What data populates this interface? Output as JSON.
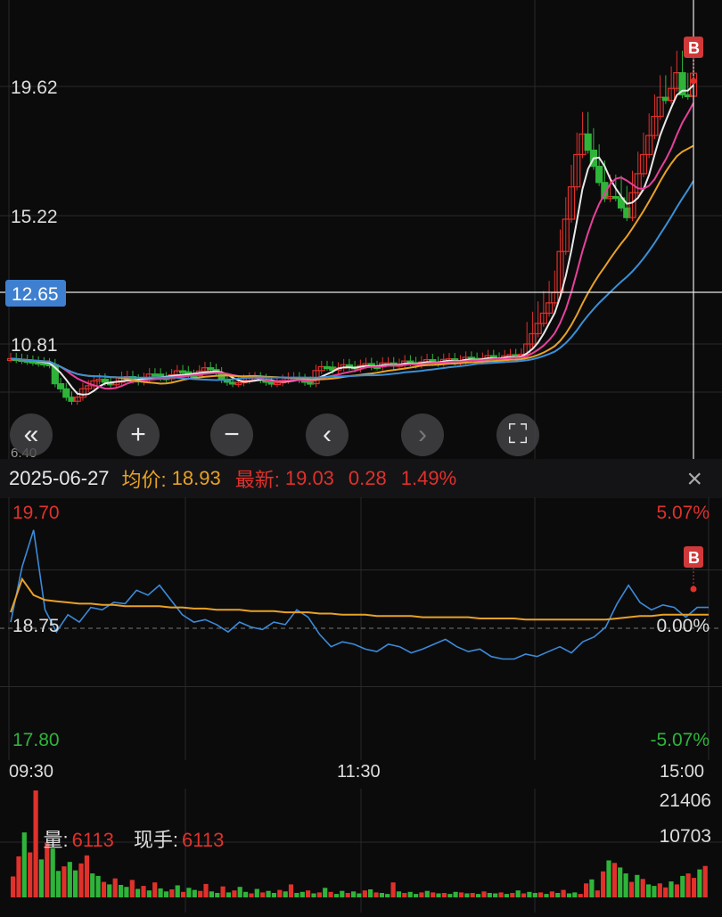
{
  "kline": {
    "price_levels": [
      "19.62",
      "15.22",
      "10.81"
    ],
    "current_price_label": "12.65",
    "bottom_label": "6.40",
    "buy_marker": "B",
    "colors": {
      "up": "#e0312b",
      "down": "#2fb43a",
      "ma5": "#e8e8e8",
      "ma10": "#e8409a",
      "ma20": "#e8a126",
      "ma30": "#3a8fd6",
      "price_tag": "#3f7fd0"
    }
  },
  "controls": [
    {
      "name": "rewind-button",
      "icon": "double-chevron-left-icon",
      "glyph": "«",
      "enabled": true
    },
    {
      "name": "zoom-in-button",
      "icon": "plus-icon",
      "glyph": "+",
      "enabled": true
    },
    {
      "name": "zoom-out-button",
      "icon": "minus-icon",
      "glyph": "−",
      "enabled": true
    },
    {
      "name": "prev-button",
      "icon": "chevron-left-icon",
      "glyph": "‹",
      "enabled": true
    },
    {
      "name": "next-button",
      "icon": "chevron-right-icon",
      "glyph": "›",
      "enabled": false
    },
    {
      "name": "fullscreen-button",
      "icon": "expand-icon",
      "glyph": "⛶",
      "enabled": true
    }
  ],
  "info": {
    "date": "2025-06-27",
    "avg_label": "均价:",
    "avg_value": "18.93",
    "latest_label": "最新:",
    "latest_value": "19.03",
    "change": "0.28",
    "change_pct": "1.49%",
    "close_glyph": "×"
  },
  "chart_data": {
    "type": "line",
    "title": "",
    "y_labels": {
      "top_left": "19.70",
      "mid_left": "18.75",
      "bottom_left": "17.80",
      "top_right": "5.07%",
      "mid_right": "0.00%",
      "bottom_right": "-5.07%"
    },
    "ylim": [
      17.8,
      19.7
    ],
    "reference": 18.75,
    "x_ticks": [
      "09:30",
      "11:30",
      "15:00"
    ],
    "series": [
      {
        "values": [
          18.8,
          19.25,
          19.55,
          18.9,
          18.72,
          18.86,
          18.8,
          18.92,
          18.9,
          18.96,
          18.95,
          19.06,
          19.02,
          19.1,
          18.98,
          18.86,
          18.8,
          18.82,
          18.78,
          18.72,
          18.8,
          18.76,
          18.74,
          18.8,
          18.78,
          18.9,
          18.84,
          18.7,
          18.6,
          18.64,
          18.62,
          18.58,
          18.56,
          18.62,
          18.6,
          18.55,
          18.58,
          18.62,
          18.66,
          18.6,
          18.56,
          18.58,
          18.52,
          18.5,
          18.5,
          18.54,
          18.52,
          18.56,
          18.6,
          18.55,
          18.64,
          18.68,
          18.76,
          18.95,
          19.1,
          18.96,
          18.9,
          18.94,
          18.92,
          18.84,
          18.92,
          18.92
        ]
      },
      {
        "values": [
          18.88,
          19.15,
          19.02,
          18.98,
          18.97,
          18.96,
          18.95,
          18.95,
          18.94,
          18.94,
          18.93,
          18.93,
          18.93,
          18.93,
          18.92,
          18.92,
          18.91,
          18.91,
          18.9,
          18.9,
          18.9,
          18.89,
          18.89,
          18.89,
          18.88,
          18.88,
          18.88,
          18.87,
          18.87,
          18.86,
          18.86,
          18.86,
          18.85,
          18.85,
          18.85,
          18.85,
          18.84,
          18.84,
          18.84,
          18.84,
          18.84,
          18.83,
          18.83,
          18.83,
          18.83,
          18.82,
          18.82,
          18.82,
          18.82,
          18.82,
          18.82,
          18.82,
          18.82,
          18.83,
          18.84,
          18.85,
          18.85,
          18.86,
          18.86,
          18.86,
          18.86,
          18.86
        ]
      }
    ],
    "volume": {
      "labels": {
        "vol_label": "量:",
        "vol_value": "6113",
        "hand_label": "现手:",
        "hand_value": "6113",
        "ymax": "21406",
        "ymid": "10703"
      },
      "ylim": [
        0,
        21406
      ],
      "values": [
        4200,
        8200,
        13000,
        9000,
        21406,
        7600,
        11000,
        9800,
        5300,
        6200,
        7100,
        5400,
        6800,
        8400,
        4800,
        4300,
        3100,
        2600,
        3800,
        2500,
        2100,
        3500,
        1700,
        2300,
        1400,
        3000,
        1800,
        1200,
        1600,
        2400,
        1100,
        1900,
        1500,
        1300,
        2700,
        1200,
        900,
        2200,
        1000,
        1400,
        2100,
        1100,
        800,
        1700,
        1000,
        1300,
        900,
        1500,
        1200,
        2600,
        900,
        1100,
        1400,
        800,
        1000,
        1900,
        1100,
        700,
        1300,
        900,
        1200,
        800,
        1400,
        1600,
        1000,
        900,
        700,
        3000,
        1200,
        900,
        1100,
        700,
        1000,
        1300,
        1000,
        800,
        900,
        700,
        1100,
        1000,
        800,
        900,
        700,
        1200,
        900,
        800,
        1000,
        700,
        900,
        1400,
        800,
        1100,
        900,
        1000,
        700,
        1200,
        900,
        1500,
        800,
        1000,
        700,
        2800,
        3600,
        1400,
        5200,
        7400,
        6900,
        6000,
        4800,
        3100,
        4500,
        3700,
        2600,
        2300,
        2800,
        2000,
        3200,
        2600,
        4300,
        4800,
        3900,
        5600,
        6300
      ],
      "up_flags": [
        1,
        1,
        0,
        1,
        1,
        0,
        1,
        0,
        0,
        1,
        0,
        0,
        1,
        1,
        0,
        0,
        1,
        0,
        1,
        0,
        0,
        1,
        0,
        1,
        0,
        1,
        0,
        0,
        1,
        0,
        1,
        0,
        0,
        1,
        1,
        0,
        0,
        1,
        0,
        1,
        0,
        0,
        1,
        0,
        1,
        0,
        0,
        1,
        0,
        1,
        0,
        0,
        1,
        0,
        1,
        0,
        1,
        0,
        0,
        1,
        0,
        0,
        1,
        0,
        1,
        0,
        0,
        1,
        0,
        1,
        0,
        0,
        1,
        0,
        1,
        0,
        1,
        0,
        0,
        1,
        0,
        1,
        0,
        1,
        0,
        0,
        1,
        0,
        1,
        0,
        1,
        0,
        0,
        1,
        0,
        1,
        0,
        1,
        0,
        0,
        1,
        1,
        0,
        1,
        1,
        0,
        1,
        0,
        0,
        1,
        0,
        1,
        0,
        0,
        1,
        1,
        0,
        1,
        0,
        1,
        1,
        0
      ]
    }
  }
}
